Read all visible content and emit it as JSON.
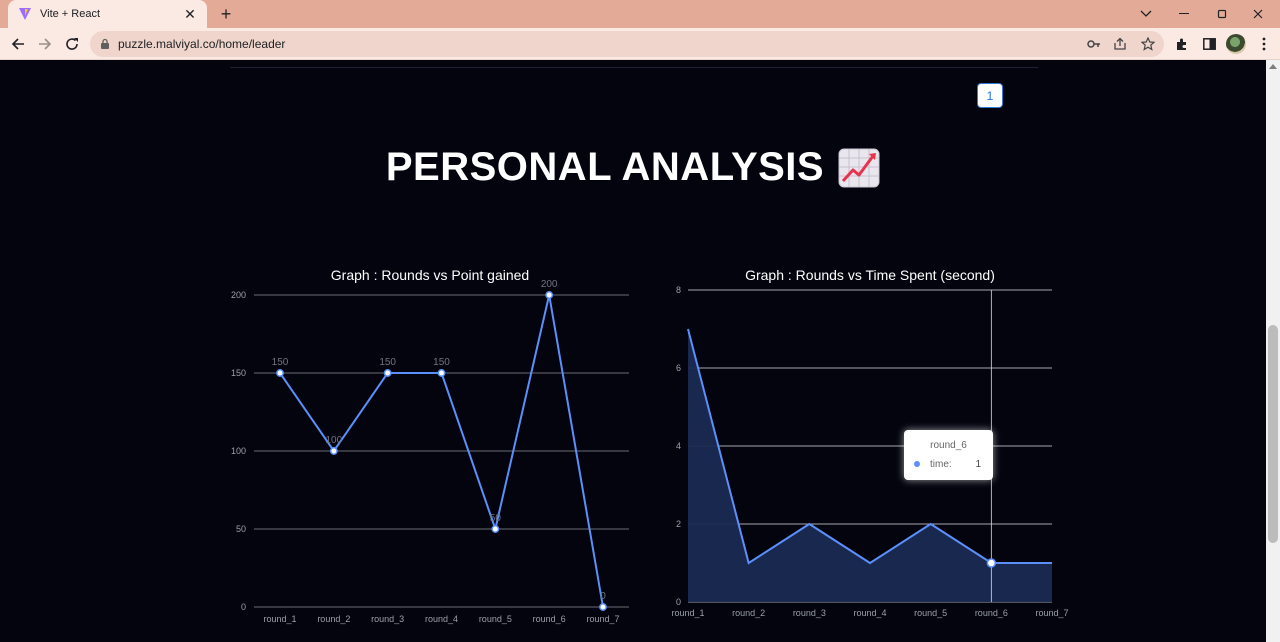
{
  "browser": {
    "tab_title": "Vite + React",
    "url": "puzzle.malviyal.co/home/leader"
  },
  "pagination": {
    "current_page": "1"
  },
  "heading": {
    "text": "PERSONAL ANALYSIS",
    "emoji_icon": "chart-increasing-icon"
  },
  "chart_data": [
    {
      "type": "line",
      "title": "Graph : Rounds vs Point gained",
      "categories": [
        "round_1",
        "round_2",
        "round_3",
        "round_4",
        "round_5",
        "round_6",
        "round_7"
      ],
      "series": [
        {
          "values": [
            150,
            100,
            150,
            150,
            50,
            200,
            0
          ]
        }
      ],
      "data_labels": [
        "150",
        "100",
        "150",
        "150",
        "50",
        "200",
        "0"
      ],
      "y_ticks": [
        "0",
        "50",
        "100",
        "150",
        "200"
      ],
      "ylim": [
        0,
        200
      ],
      "grid": true,
      "line_color": "#5b8ff9"
    },
    {
      "type": "area",
      "title": "Graph : Rounds vs Time Spent (second)",
      "categories": [
        "round_1",
        "round_2",
        "round_3",
        "round_4",
        "round_5",
        "round_6",
        "round_7"
      ],
      "series": [
        {
          "name": "time",
          "values": [
            7,
            1,
            2,
            1,
            2,
            1,
            1
          ]
        }
      ],
      "y_ticks": [
        "0",
        "2",
        "4",
        "6",
        "8"
      ],
      "ylim": [
        0,
        8
      ],
      "grid": true,
      "line_color": "#5b8ff9",
      "fill_color": "#1a2a52",
      "tooltip": {
        "title": "round_6",
        "name": "time:",
        "value": "1",
        "hover_index": 5
      }
    }
  ]
}
